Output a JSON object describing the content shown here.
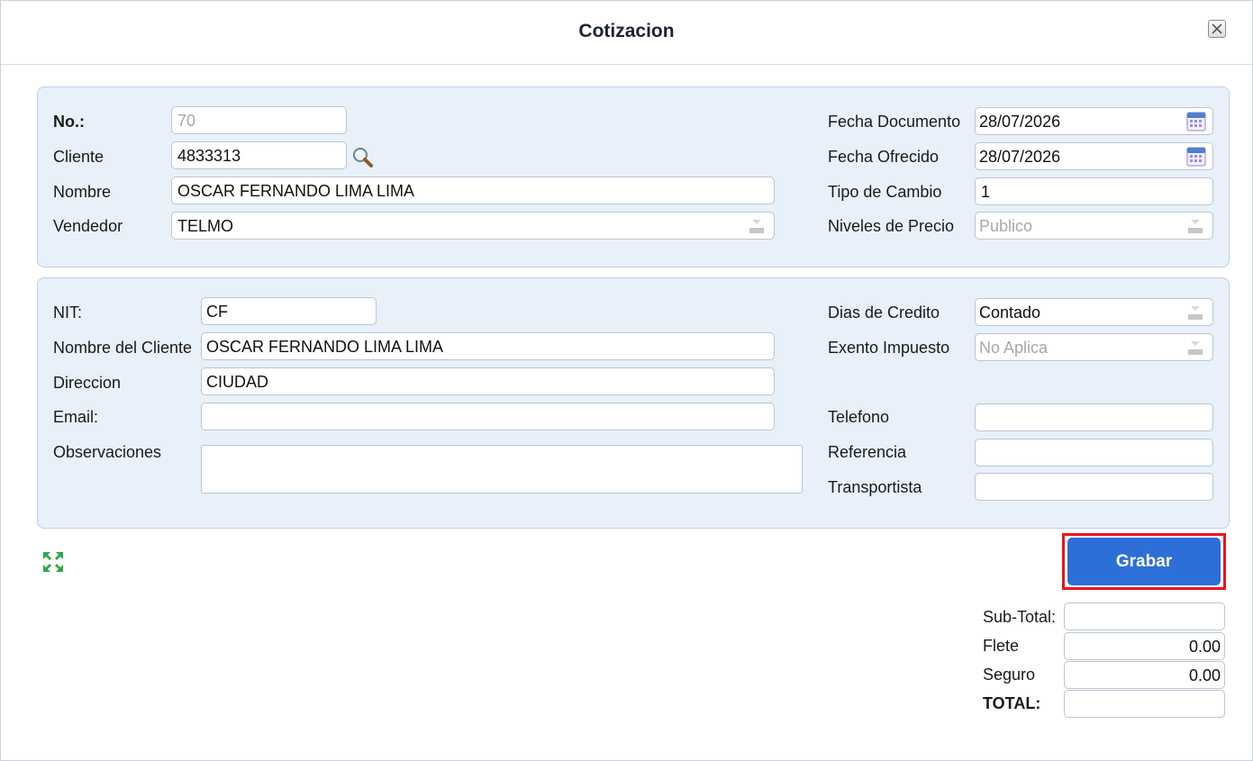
{
  "window": {
    "title": "Cotizacion"
  },
  "header": {
    "no_label": "No.:",
    "no_value": "70",
    "cliente_label": "Cliente",
    "cliente_value": "4833313",
    "nombre_label": "Nombre",
    "nombre_value": "OSCAR FERNANDO LIMA LIMA",
    "vendedor_label": "Vendedor",
    "vendedor_value": "TELMO",
    "fecha_documento_label": "Fecha Documento",
    "fecha_documento_value": "28/07/2026",
    "fecha_ofrecido_label": "Fecha Ofrecido",
    "fecha_ofrecido_value": "28/07/2026",
    "tipo_cambio_label": "Tipo de Cambio",
    "tipo_cambio_value": "1",
    "niveles_precio_label": "Niveles de Precio",
    "niveles_precio_value": "Publico"
  },
  "customer": {
    "nit_label": "NIT:",
    "nit_value": "CF",
    "nombre_cliente_label": "Nombre del Cliente",
    "nombre_cliente_value": "OSCAR FERNANDO LIMA LIMA",
    "direccion_label": "Direccion",
    "direccion_value": "CIUDAD",
    "email_label": "Email:",
    "email_value": "",
    "observaciones_label": "Observaciones",
    "observaciones_value": "",
    "dias_credito_label": "Dias de Credito",
    "dias_credito_value": "Contado",
    "exento_label": "Exento Impuesto",
    "exento_value": "No Aplica",
    "telefono_label": "Telefono",
    "telefono_value": "",
    "referencia_label": "Referencia",
    "referencia_value": "",
    "transportista_label": "Transportista",
    "transportista_value": ""
  },
  "actions": {
    "grabar_label": "Grabar"
  },
  "totals": {
    "subtotal_label": "Sub-Total:",
    "subtotal_value": "",
    "flete_label": "Flete",
    "flete_value": "0.00",
    "seguro_label": "Seguro",
    "seguro_value": "0.00",
    "total_label": "TOTAL:",
    "total_value": ""
  },
  "icons": {
    "close": "close-icon",
    "search": "magnifier-icon",
    "calendar": "calendar-icon",
    "dropdown": "chevron-down-icon",
    "expand": "expand-icon"
  },
  "colors": {
    "panel_bg": "#e8f0fa",
    "primary_button": "#2c6fd6",
    "highlight_border": "#e8161d"
  }
}
